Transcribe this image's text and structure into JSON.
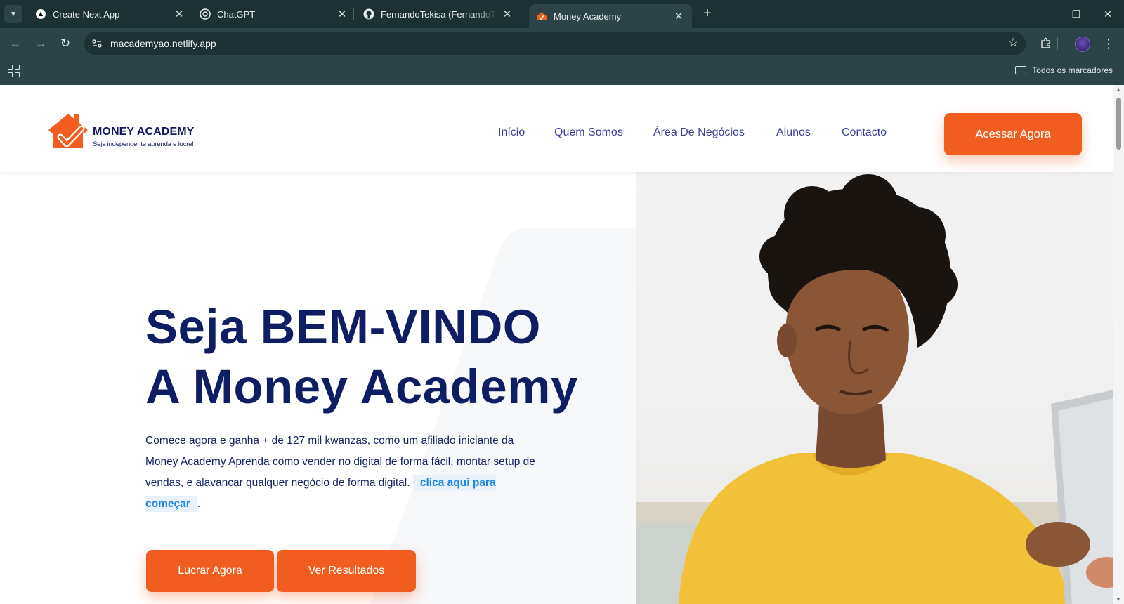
{
  "browser": {
    "tabs": [
      {
        "title": "Create Next App",
        "icon": "nextjs-icon",
        "active": false
      },
      {
        "title": "ChatGPT",
        "icon": "chatgpt-icon",
        "active": false
      },
      {
        "title": "FernandoTekisa (FernandoTekisa)",
        "icon": "github-icon",
        "active": false
      },
      {
        "title": "Money Academy",
        "icon": "money-academy-favicon",
        "active": true
      }
    ],
    "url": "macademyao.netlify.app",
    "bookmarks_all_label": "Todos os marcadores"
  },
  "site": {
    "logo": {
      "brand": "MONEY ACADEMY",
      "tagline": "Seja independente aprenda e lucre!"
    },
    "nav": [
      "Início",
      "Quem Somos",
      "Área De Negócios",
      "Alunos",
      "Contacto"
    ],
    "header_cta": "Acessar Agora",
    "hero": {
      "title_line1": "Seja BEM-VINDO",
      "title_line2": "A Money Academy",
      "text": "Comece agora e ganha + de 127 mil kwanzas, como um afiliado iniciante da Money Academy Aprenda como vender no digital de forma fácil, montar setup de vendas, e alavancar qualquer negócio de forma digital.",
      "link": "clica aqui para começar",
      "text_end": ".",
      "button_primary": "Lucrar Agora",
      "button_secondary": "Ver Resultados"
    },
    "colors": {
      "accent": "#f05d1e",
      "navy": "#0f1e63",
      "nav_text": "#3c3d9a",
      "link": "#1e88e5"
    }
  }
}
